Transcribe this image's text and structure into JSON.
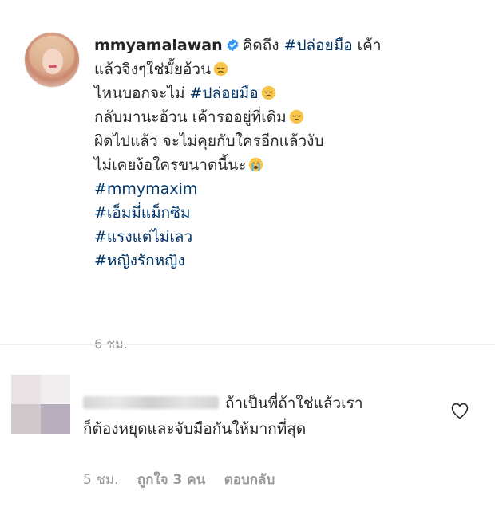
{
  "post": {
    "username": "mmyamalawan",
    "caption_lines": [
      {
        "pre": "คิดถึง ",
        "tag": "#ปล่อยมือ",
        "post": " เค้า"
      },
      {
        "pre": "แล้วจิงๆใช่มั้ยอ้วน",
        "emoji": "sad-face"
      },
      {
        "pre": "ไหนบอกจะไม่ ",
        "tag": "#ปล่อยมือ",
        "emoji": "sad-face"
      },
      {
        "pre": "กลับมานะอ้วน เค้ารออยู่ที่เดิม",
        "emoji": "sad-face"
      },
      {
        "pre": "ผิดไปแล้ว จะไม่คุยกับใครอีกแล้วงับ"
      },
      {
        "pre": "ไม่เคยง้อใครขนาดนี้นะ",
        "emoji": "crying-face"
      }
    ],
    "hashtags": [
      "#mmymaxim",
      "#เอ็มมี่แม็กซิม",
      "#แรงแต่ไม่เลว",
      "#หญิงรักหญิง"
    ],
    "time": "6 ชม."
  },
  "comment": {
    "text_line1": "ถ้าเป็นพี่ถ้าใช่แล้วเรา",
    "text_line2": "ก็ต้องหยุดและจับมือกันให้มากที่สุด",
    "time": "5 ชม.",
    "likes": "ถูกใจ 3 คน",
    "reply_label": "ตอบกลับ"
  },
  "colors": {
    "hashtag": "#003569",
    "text": "#262626",
    "muted": "#999999",
    "verified": "#3897f0"
  }
}
